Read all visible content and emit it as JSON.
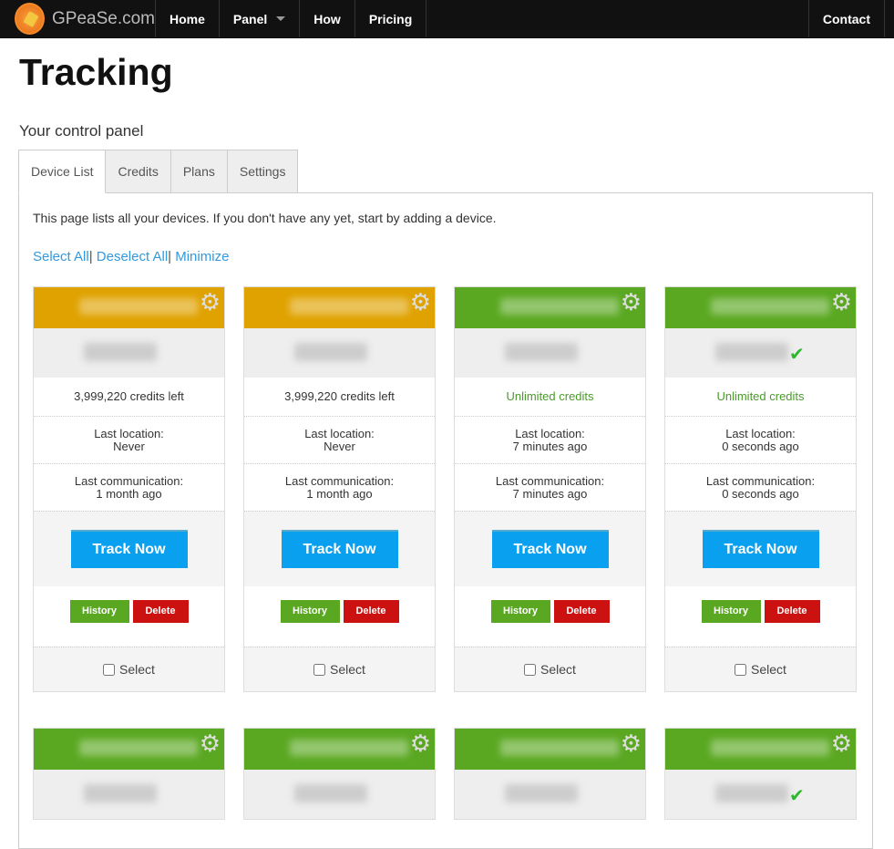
{
  "nav": {
    "brand": "GPeaSe.com",
    "items": [
      "Home",
      "Panel",
      "How",
      "Pricing"
    ],
    "contact": "Contact"
  },
  "page": {
    "title": "Tracking",
    "subtitle": "Your control panel",
    "intro": "This page lists all your devices. If you don't have any yet, start by adding a device."
  },
  "tabs": [
    "Device List",
    "Credits",
    "Plans",
    "Settings"
  ],
  "links": {
    "select_all": "Select All",
    "deselect_all": "Deselect All",
    "minimize": "Minimize",
    "sep": "|"
  },
  "labels": {
    "last_location": "Last location:",
    "last_communication": "Last communication:",
    "track": "Track Now",
    "history": "History",
    "delete": "Delete",
    "select": "Select"
  },
  "colors": {
    "low": "#e0a200",
    "ok": "#5aa821"
  },
  "devices": [
    {
      "status": "orange",
      "credits": "3,999,220 credits left",
      "last_location": "Never",
      "last_communication": "1 month ago"
    },
    {
      "status": "orange",
      "credits": "3,999,220 credits left",
      "last_location": "Never",
      "last_communication": "1 month ago"
    },
    {
      "status": "green",
      "credits": "Unlimited credits",
      "last_location": "7 minutes ago",
      "last_communication": "7 minutes ago"
    },
    {
      "status": "green",
      "credits": "Unlimited credits",
      "last_location": "0 seconds ago",
      "last_communication": "0 seconds ago"
    },
    {
      "status": "green"
    },
    {
      "status": "green"
    },
    {
      "status": "green"
    },
    {
      "status": "green"
    }
  ]
}
